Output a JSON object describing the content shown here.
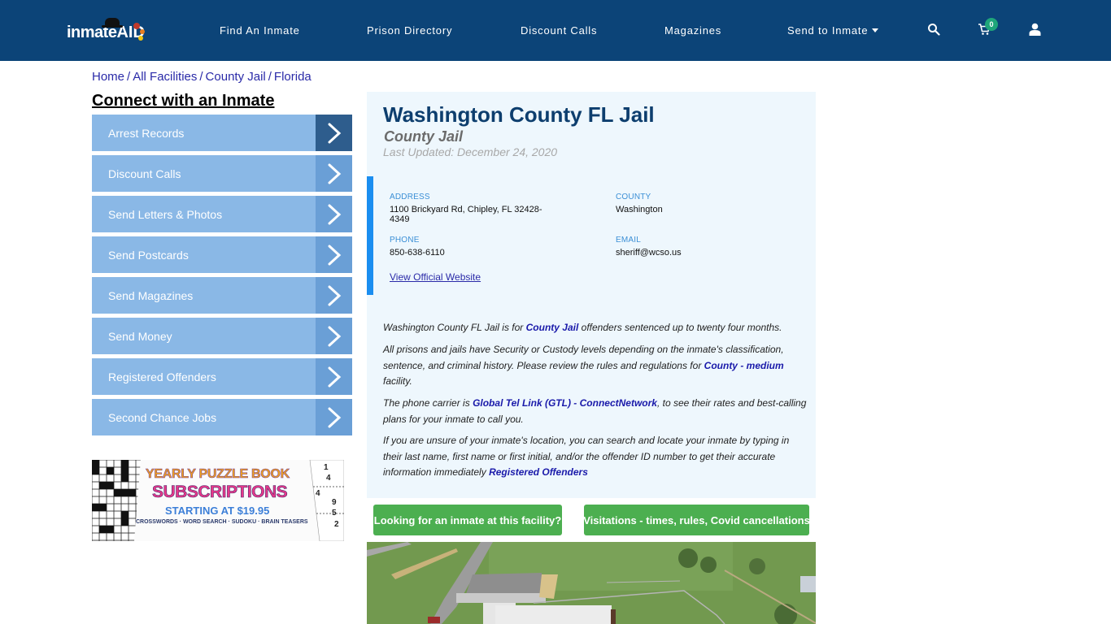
{
  "nav": {
    "logo_text": "inmate",
    "logo_accent": "AID",
    "items": [
      {
        "label": "Find An Inmate"
      },
      {
        "label": "Prison Directory"
      },
      {
        "label": "Discount Calls"
      },
      {
        "label": "Magazines"
      },
      {
        "label": "Send to Inmate"
      }
    ],
    "cart_count": "0",
    "icons": [
      "search-icon",
      "cart-icon",
      "user-icon"
    ]
  },
  "breadcrumb": [
    {
      "label": "Home"
    },
    {
      "label": "All Facilities"
    },
    {
      "label": "County Jail"
    },
    {
      "label": "Florida"
    }
  ],
  "breadcrumb_sep": "/",
  "sidebar": {
    "title": "Connect with an Inmate",
    "items": [
      {
        "label": "Arrest Records"
      },
      {
        "label": "Discount Calls"
      },
      {
        "label": "Send Letters & Photos"
      },
      {
        "label": "Send Postcards"
      },
      {
        "label": "Send Magazines"
      },
      {
        "label": "Send Money"
      },
      {
        "label": "Registered Offenders"
      },
      {
        "label": "Second Chance Jobs"
      }
    ],
    "ad": {
      "line1": "YEARLY PUZZLE BOOK",
      "line2": "SUBSCRIPTIONS",
      "line3": "STARTING AT $19.95",
      "line4": "CROSSWORDS · WORD SEARCH · SUDOKU · BRAIN TEASERS",
      "sudoku_digits": [
        "1",
        "4",
        "4",
        "9",
        "5",
        "2"
      ]
    }
  },
  "facility": {
    "name": "Washington County FL Jail",
    "type": "County Jail",
    "last_updated": "Last Updated: December 24, 2020",
    "address_label": "ADDRESS",
    "address_line1": "1100 Brickyard Rd, Chipley, FL 32428-",
    "address_line2": "4349",
    "county_label": "COUNTY",
    "county": "Washington",
    "phone_label": "PHONE",
    "phone": "850-638-6110",
    "email_label": "EMAIL",
    "email": "sheriff@wcso.us",
    "website_link": "View Official Website"
  },
  "description": {
    "p1_a": "Washington County FL Jail is for ",
    "p1_link": "County Jail",
    "p1_b": " offenders sentenced up to twenty four months.",
    "p2_a": "All prisons and jails have Security or Custody levels depending on the inmate's classification, sentence, and criminal history. Please review the rules and regulations for ",
    "p2_link": "County - medium",
    "p2_b": " facility.",
    "p3_a": "The phone carrier is ",
    "p3_link": "Global Tel Link (GTL) - ConnectNetwork",
    "p3_b": ", to see their rates and best-calling plans for your inmate to call you.",
    "p4_a": "If you are unsure of your inmate's location, you can search and locate your inmate by typing in their last name, first name or first initial, and/or the offender ID number to get their accurate information immediately ",
    "p4_link": "Registered Offenders"
  },
  "buttons": {
    "find_inmate": "Looking for an inmate at this facility?",
    "visitations": "Visitations - times, rules, Covid cancellations"
  },
  "colors": {
    "navbar": "#0c4478",
    "sidebar_item": "#8ab8e6",
    "sidebar_arrow": "#6a9fd6",
    "sidebar_arrow_active": "#2e5d8d",
    "title": "#0d3e6e",
    "info_bar": "#1b8ef0",
    "green_button": "#4caf50",
    "link": "#1a1aaa"
  }
}
